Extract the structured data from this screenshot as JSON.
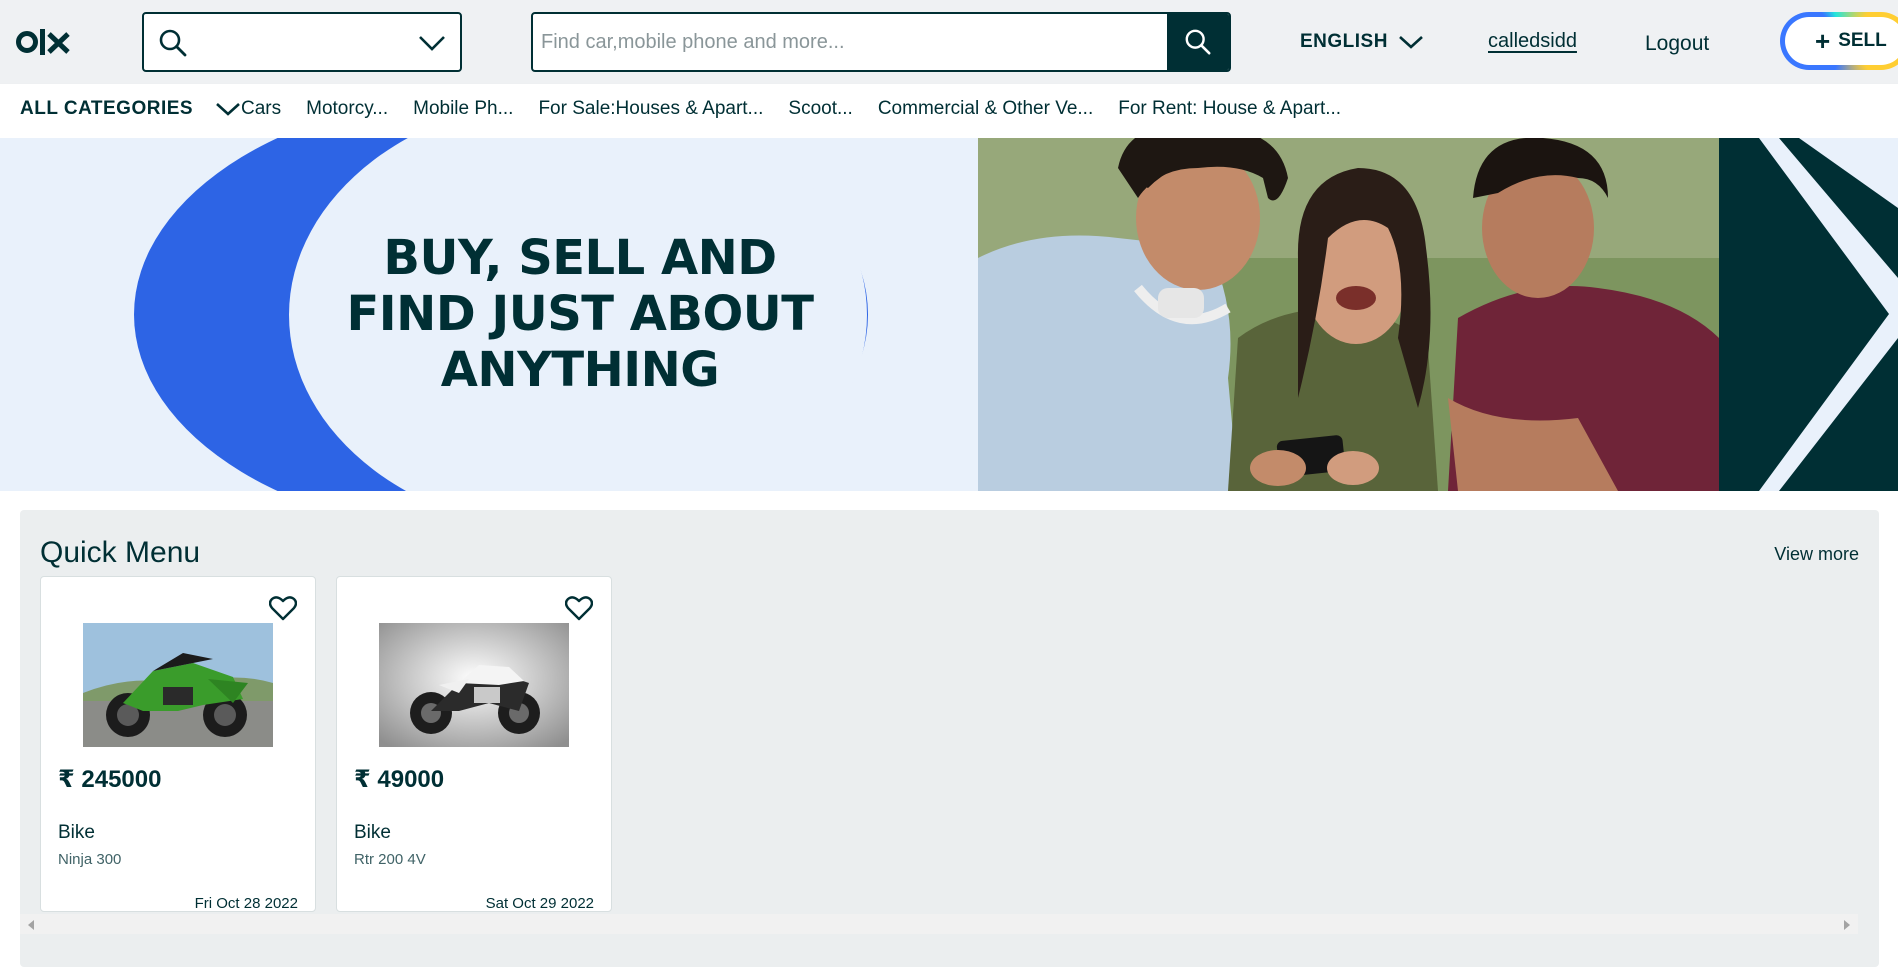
{
  "header": {
    "logo_text": "olx",
    "search_placeholder": "Find car,mobile phone and more...",
    "language": "ENGLISH",
    "username": "calledsidd",
    "logout_label": "Logout",
    "sell_label": "SELL"
  },
  "categories": {
    "all_label": "ALL CATEGORIES",
    "items": [
      "Cars",
      "Motorcy...",
      "Mobile Ph...",
      "For Sale:Houses & Apart...",
      "Scoot...",
      "Commercial & Other Ve...",
      "For Rent: House & Apart..."
    ]
  },
  "banner": {
    "tagline_line1": "BUY, SELL AND",
    "tagline_line2": "FIND JUST ABOUT",
    "tagline_line3": "ANYTHING"
  },
  "quick_menu": {
    "title": "Quick Menu",
    "view_more": "View more",
    "items": [
      {
        "price": "₹ 245000",
        "category": "Bike",
        "name": "Ninja 300",
        "date": "Fri Oct 28 2022",
        "image_icon": "green-sport-bike-image"
      },
      {
        "price": "₹ 49000",
        "category": "Bike",
        "name": "Rtr 200 4V",
        "date": "Sat Oct 29 2022",
        "image_icon": "white-street-bike-image"
      }
    ]
  },
  "colors": {
    "brand_dark": "#002f34",
    "banner_blue": "#2d64e5",
    "banner_light": "#e9f1fb",
    "header_bg": "#eff1f3",
    "quick_menu_bg": "#ebeeef"
  }
}
